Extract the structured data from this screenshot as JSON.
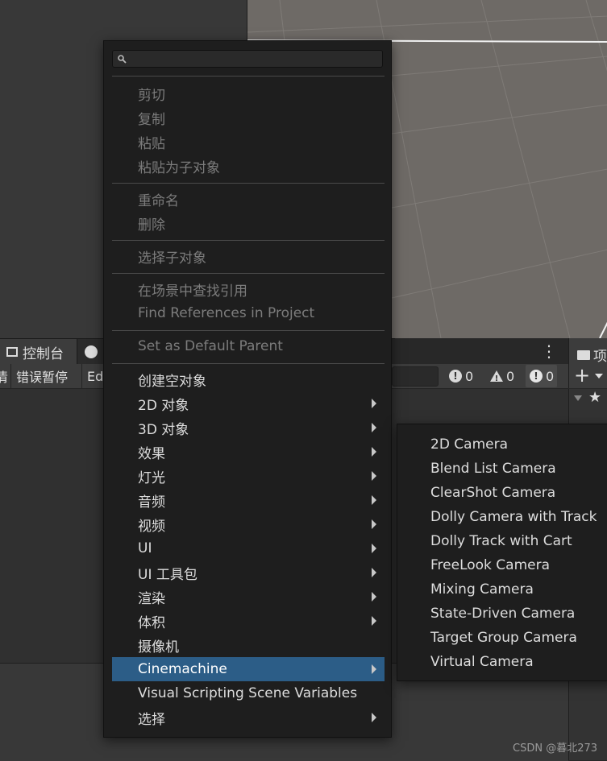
{
  "console": {
    "tab_label": "控制台",
    "toolbar": {
      "clear_partial": "清",
      "error_pause": "错误暂停",
      "editor_partial": "Ed"
    },
    "counts": {
      "errors": "0",
      "warnings": "0",
      "logs": "0"
    }
  },
  "project": {
    "tab_partial": "项"
  },
  "menu": {
    "search": {
      "placeholder": ""
    },
    "groups": [
      {
        "items": [
          {
            "label": "剪切",
            "disabled": true
          },
          {
            "label": "复制",
            "disabled": true
          },
          {
            "label": "粘贴",
            "disabled": true
          },
          {
            "label": "粘贴为子对象",
            "disabled": true
          }
        ]
      },
      {
        "items": [
          {
            "label": "重命名",
            "disabled": true
          },
          {
            "label": "删除",
            "disabled": true
          }
        ]
      },
      {
        "items": [
          {
            "label": "选择子对象",
            "disabled": true
          }
        ]
      },
      {
        "items": [
          {
            "label": "在场景中查找引用",
            "disabled": true
          },
          {
            "label": "Find References in Project",
            "disabled": true
          }
        ]
      },
      {
        "items": [
          {
            "label": "Set as Default Parent",
            "disabled": true
          }
        ]
      },
      {
        "items": [
          {
            "label": "创建空对象",
            "disabled": false
          },
          {
            "label": "2D 对象",
            "disabled": false,
            "submenu": true
          },
          {
            "label": "3D 对象",
            "disabled": false,
            "submenu": true
          },
          {
            "label": "效果",
            "disabled": false,
            "submenu": true
          },
          {
            "label": "灯光",
            "disabled": false,
            "submenu": true
          },
          {
            "label": "音频",
            "disabled": false,
            "submenu": true
          },
          {
            "label": "视频",
            "disabled": false,
            "submenu": true
          },
          {
            "label": "UI",
            "disabled": false,
            "submenu": true
          },
          {
            "label": "UI 工具包",
            "disabled": false,
            "submenu": true
          },
          {
            "label": "渲染",
            "disabled": false,
            "submenu": true
          },
          {
            "label": "体积",
            "disabled": false,
            "submenu": true
          },
          {
            "label": "摄像机",
            "disabled": false
          },
          {
            "label": "Cinemachine",
            "disabled": false,
            "submenu": true,
            "selected": true
          },
          {
            "label": "Visual Scripting Scene Variables",
            "disabled": false
          },
          {
            "label": "选择",
            "disabled": false,
            "submenu": true
          }
        ]
      }
    ]
  },
  "submenu": {
    "items": [
      "2D Camera",
      "Blend List Camera",
      "ClearShot Camera",
      "Dolly Camera with Track",
      "Dolly Track with Cart",
      "FreeLook Camera",
      "Mixing Camera",
      "State-Driven Camera",
      "Target Group Camera",
      "Virtual Camera"
    ]
  },
  "watermark": "CSDN @暮北273",
  "colors": {
    "selection": "#2c5d87",
    "menu_bg": "#1e1e1e",
    "scene_bg": "#6e6a66"
  }
}
